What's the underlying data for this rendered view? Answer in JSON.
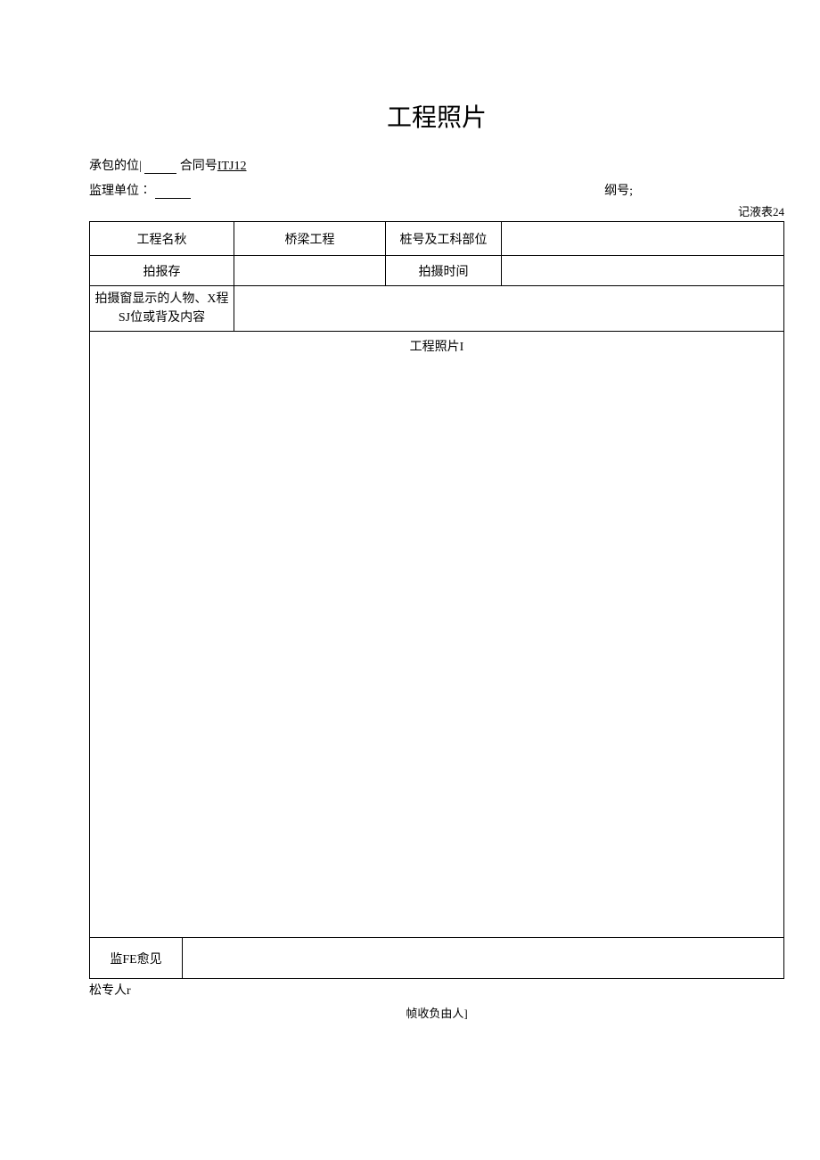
{
  "title": "工程照片",
  "info": {
    "contractor_label": "承包的位| ",
    "contract_label": "合同号",
    "contract_no": "ITJ12",
    "supervisor_label": "监理单位∶",
    "number_label": "纲号;"
  },
  "table_corner": "记液表24",
  "rows": {
    "project_name_label": "工程名秋",
    "project_name_value": "桥梁工程",
    "station_label": "桩号及工科部位",
    "station_value": "",
    "photo_save_label": "拍报存",
    "photo_save_value": "",
    "photo_time_label": "拍摄时间",
    "photo_time_value": "",
    "desc_label": "拍摄窗显示的人物、X程SJ位或背及内容",
    "photo_caption": "工程照片I",
    "opinion_label": "监FE愈见",
    "opinion_value": ""
  },
  "footer": {
    "left": "松专人r",
    "center": "帧收负由人]"
  }
}
